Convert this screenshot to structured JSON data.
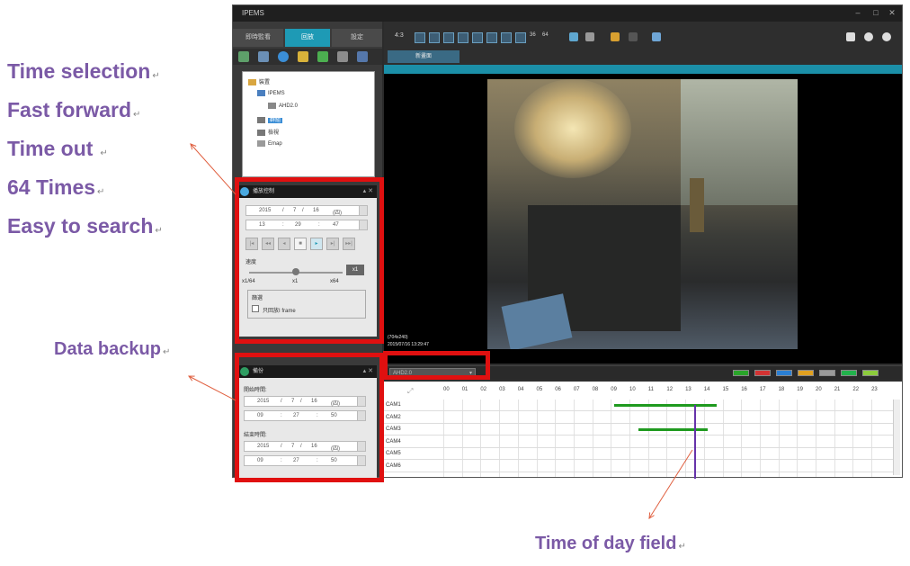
{
  "annotations": {
    "features": [
      "Time selection",
      "Fast forward",
      "Time out",
      "64 Times",
      "Easy to search"
    ],
    "data_backup": "Data backup",
    "time_of_day_field": "Time of day field",
    "return_mark": "↵"
  },
  "app": {
    "title": "IPEMS",
    "tabs": [
      "即時監看",
      "回放",
      "設定"
    ],
    "layout_label": "4:3",
    "layout_36": "36",
    "layout_64": "64",
    "view_tab": "新畫面"
  },
  "tree": {
    "root": "裝置",
    "group": "IPEMS",
    "camera": "AHD2.0",
    "item_a": "群組",
    "item_b": "檢視",
    "item_c": "Emap"
  },
  "playback": {
    "header": "播放控制",
    "date": {
      "year": "2015",
      "month": "7",
      "day": "16",
      "weekday": "(四)"
    },
    "time": {
      "h": "13",
      "m": "29",
      "s": "47"
    },
    "speed_label": "速度",
    "speed_min": "x1/64",
    "speed_mid": "x1",
    "speed_max": "x64",
    "speed_value": "x1",
    "slider_value": 0.5,
    "filter_label": "篩選",
    "iframe_label": "只回放I frame"
  },
  "backup": {
    "header": "備份",
    "start_label": "開始時間:",
    "start_date": {
      "year": "2015",
      "month": "7",
      "day": "16",
      "weekday": "(四)"
    },
    "start_time": {
      "h": "09",
      "m": "27",
      "s": "50"
    },
    "end_label": "結束時間:",
    "end_date": {
      "year": "2015",
      "month": "7",
      "day": "16",
      "weekday": "(四)"
    },
    "end_time": {
      "h": "09",
      "m": "27",
      "s": "50"
    }
  },
  "video": {
    "osd_name": "(704x240)",
    "osd_time": "2015/07/16 13:29:47"
  },
  "timeline": {
    "camera_select": "AHD2.0",
    "hours": [
      "00",
      "01",
      "02",
      "03",
      "04",
      "05",
      "06",
      "07",
      "08",
      "09",
      "10",
      "11",
      "12",
      "13",
      "14",
      "15",
      "16",
      "17",
      "18",
      "19",
      "20",
      "21",
      "22",
      "23"
    ],
    "cameras": [
      "CAM1",
      "CAM2",
      "CAM3",
      "CAM4",
      "CAM5",
      "CAM6"
    ],
    "segments": [
      {
        "camera": "CAM1",
        "start_hour": 9.2,
        "end_hour": 14.7
      },
      {
        "camera": "CAM3",
        "start_hour": 10.5,
        "end_hour": 14.2
      }
    ],
    "cursor_hour": 13.5,
    "legend_colors": [
      "#2aa52a",
      "#d33333",
      "#2a7fd3",
      "#e0a020",
      "#9a9a9a",
      "#22b24c",
      "#8ccc3c"
    ]
  },
  "colors": {
    "annotation": "#7b5aa6",
    "highlight": "#e01010",
    "accent": "#1e9ab5",
    "recording": "#1f9a1f"
  }
}
